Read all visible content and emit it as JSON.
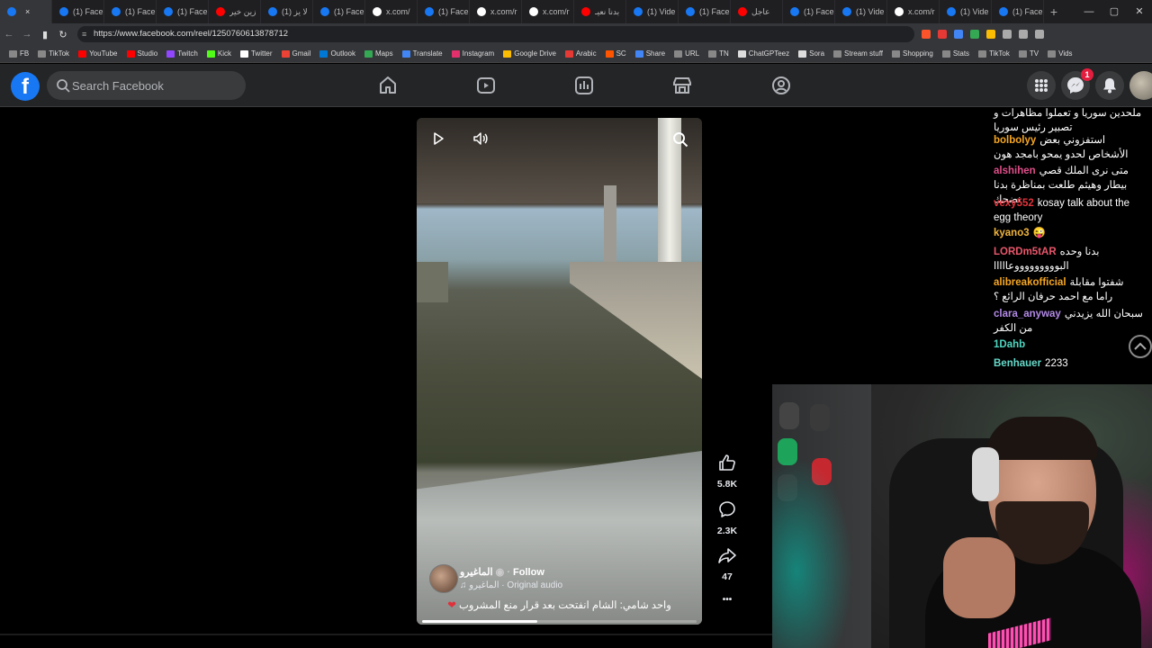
{
  "browser": {
    "tabs": [
      {
        "label": "",
        "color": "#1877f2",
        "active": true
      },
      {
        "label": "(1) Face",
        "color": "#1877f2"
      },
      {
        "label": "(1) Face",
        "color": "#1877f2"
      },
      {
        "label": "(1) Face",
        "color": "#1877f2"
      },
      {
        "label": "زين خير",
        "color": "#ff0000"
      },
      {
        "label": "(1) لا يز",
        "color": "#1877f2"
      },
      {
        "label": "(1) Face",
        "color": "#1877f2"
      },
      {
        "label": "x.com/",
        "color": "#ffffff"
      },
      {
        "label": "(1) Face",
        "color": "#1877f2"
      },
      {
        "label": "x.com/r",
        "color": "#ffffff"
      },
      {
        "label": "x.com/r",
        "color": "#ffffff"
      },
      {
        "label": "بدنا نعيـ",
        "color": "#ff0000"
      },
      {
        "label": "(1) Vide",
        "color": "#1877f2"
      },
      {
        "label": "(1) Face",
        "color": "#1877f2"
      },
      {
        "label": "عاجل",
        "color": "#ff0000"
      },
      {
        "label": "(1) Face",
        "color": "#1877f2"
      },
      {
        "label": "(1) Vide",
        "color": "#1877f2"
      },
      {
        "label": "x.com/r",
        "color": "#ffffff"
      },
      {
        "label": "(1) Vide",
        "color": "#1877f2"
      },
      {
        "label": "(1) Face",
        "color": "#1877f2"
      }
    ],
    "new_tab": "+",
    "url": "https://www.facebook.com/reel/1250760613878712",
    "bookmarks": [
      {
        "label": "FB",
        "color": "#888888"
      },
      {
        "label": "TikTok",
        "color": "#888888"
      },
      {
        "label": "YouTube",
        "color": "#ff0000"
      },
      {
        "label": "Studio",
        "color": "#ff0000"
      },
      {
        "label": "Twitch",
        "color": "#9146ff"
      },
      {
        "label": "Kick",
        "color": "#53fc18"
      },
      {
        "label": "Twitter",
        "color": "#ffffff"
      },
      {
        "label": "Gmail",
        "color": "#ea4335"
      },
      {
        "label": "Outlook",
        "color": "#0078d4"
      },
      {
        "label": "Maps",
        "color": "#34a853"
      },
      {
        "label": "Translate",
        "color": "#4285f4"
      },
      {
        "label": "Instagram",
        "color": "#e1306c"
      },
      {
        "label": "Google Drive",
        "color": "#fbbc04"
      },
      {
        "label": "Arabic",
        "color": "#e53935"
      },
      {
        "label": "SC",
        "color": "#ff5500"
      },
      {
        "label": "Share",
        "color": "#4285f4"
      },
      {
        "label": "URL",
        "color": "#888888"
      },
      {
        "label": "TN",
        "color": "#888888"
      },
      {
        "label": "ChatGPTeez",
        "color": "#dddddd"
      },
      {
        "label": "Sora",
        "color": "#dddddd"
      },
      {
        "label": "Stream stuff",
        "color": "#888888"
      },
      {
        "label": "Shopping",
        "color": "#888888"
      },
      {
        "label": "Stats",
        "color": "#888888"
      },
      {
        "label": "TikTok",
        "color": "#888888"
      },
      {
        "label": "TV",
        "color": "#888888"
      },
      {
        "label": "Vids",
        "color": "#888888"
      }
    ]
  },
  "facebook": {
    "logo": "f",
    "search_placeholder": "Search Facebook",
    "nav_icons": [
      "home-icon",
      "video-icon",
      "feeds-icon",
      "marketplace-icon",
      "groups-icon"
    ],
    "messenger_badge": "1"
  },
  "reel": {
    "owner": "الماغيرو",
    "follow": "Follow",
    "audio": "الماغيرو · Original audio",
    "caption": "واحد شامي: الشام انفتحت بعد قرار منع المشروب",
    "progress": 0.42,
    "likes": "5.8K",
    "comments": "2.3K",
    "shares": "47",
    "more": "•••"
  },
  "chat": [
    {
      "user": "",
      "color": "#ffffff",
      "text": "ملحدين سوريا و تعملوا مظاهرات و تصبير رئيس سوريا"
    },
    {
      "user": "bolbolyy",
      "color": "#f5a623",
      "text": "استفزوني بعض الأشخاص لحدو يمحو بامجد هون"
    },
    {
      "user": "alshihen",
      "color": "#e04e8a",
      "text": "متى نرى الملك قصي بيطار وهيثم طلعت بمناظرة بدنا نضحك"
    },
    {
      "user": "vexy552",
      "color": "#e0343d",
      "text": "kosay talk about the egg theory"
    },
    {
      "user": "kyano3",
      "color": "#f0b43c",
      "text": "😜"
    },
    {
      "user": "LORDm5tAR",
      "color": "#e8566b",
      "text": "بدنا وحده البوووووووووعااااا"
    },
    {
      "user": "alibreakofficial",
      "color": "#f5a623",
      "text": "شفتوا مقابلة راما مع احمد حرفان الرائع ؟"
    },
    {
      "user": "clara_anyway",
      "color": "#b28ae6",
      "text": "سبحان الله يزيدني من الكفر"
    },
    {
      "user": "1Dahb",
      "color": "#4fd6c0",
      "text": ""
    },
    {
      "user": "Benhauer",
      "color": "#66d9c9",
      "text": "2233"
    }
  ]
}
